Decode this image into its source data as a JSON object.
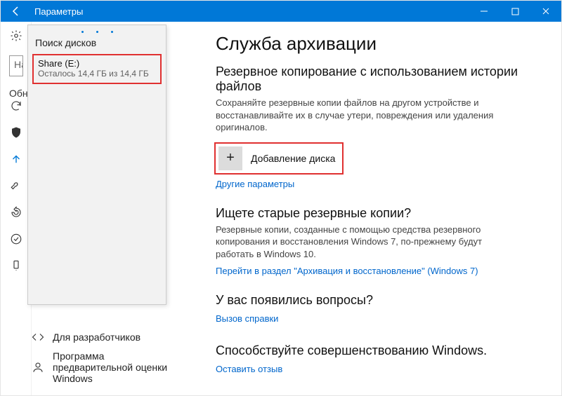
{
  "titlebar": {
    "title": "Параметры"
  },
  "search": {
    "placeholder": "На"
  },
  "truncated_label": "Обн",
  "panel": {
    "heading": "Поиск дисков",
    "disk": {
      "name": "Share (E:)",
      "info": "Осталось 14,4 ГБ из 14,4 ГБ"
    }
  },
  "main": {
    "h1": "Служба архивации",
    "section1_h2": "Резервное копирование с использованием истории файлов",
    "section1_desc": "Сохраняйте резервные копии файлов на другом устройстве и восстанавливайте их в случае утери, повреждения или удаления оригиналов.",
    "add_drive": "Добавление диска",
    "more_options": "Другие параметры",
    "section2_h2": "Ищете старые резервные копии?",
    "section2_desc": "Резервные копии, созданные с помощью средства резервного копирования и восстановления Windows 7, по-прежнему будут работать в Windows 10.",
    "link_w7": "Перейти в раздел \"Архивация и восстановление\" (Windows 7)",
    "section3_h2": "У вас появились вопросы?",
    "help_link": "Вызов справки",
    "section4_h2": "Способствуйте совершенствованию Windows.",
    "feedback_link": "Оставить отзыв"
  },
  "bottom": {
    "dev": "Для разработчиков",
    "insider": "Программа предварительной оценки Windows"
  }
}
